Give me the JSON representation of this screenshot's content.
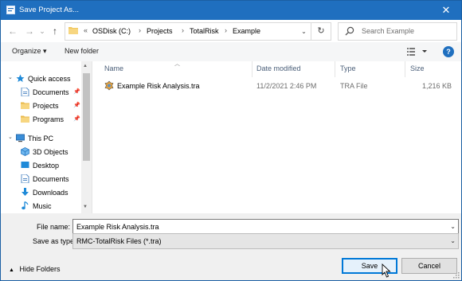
{
  "window": {
    "title": "Save Project As...",
    "close_glyph": "✕"
  },
  "nav": {
    "back_glyph": "←",
    "forward_glyph": "→",
    "recent_glyph": "⌄",
    "up_glyph": "↑",
    "breadcrumb_prefix": "«",
    "breadcrumbs": [
      "OSDisk (C:)",
      "Projects",
      "TotalRisk",
      "Example"
    ],
    "separator": "›",
    "dropdown_glyph": "⌄",
    "refresh_glyph": "↻",
    "search_placeholder": "Search Example"
  },
  "toolbar": {
    "organize_label": "Organize ▾",
    "new_folder_label": "New folder",
    "help_label": "?"
  },
  "sidebar": {
    "items": [
      {
        "label": "Quick access",
        "icon": "star-icon",
        "pinned": false
      },
      {
        "label": "Documents",
        "icon": "documents-icon",
        "pinned": true
      },
      {
        "label": "Projects",
        "icon": "folder-icon",
        "pinned": true
      },
      {
        "label": "Programs",
        "icon": "folder-icon",
        "pinned": true
      },
      {
        "label": "This PC",
        "icon": "computer-icon",
        "pinned": false
      },
      {
        "label": "3D Objects",
        "icon": "3d-objects-icon",
        "pinned": false
      },
      {
        "label": "Desktop",
        "icon": "desktop-icon",
        "pinned": false
      },
      {
        "label": "Documents",
        "icon": "documents-icon",
        "pinned": false
      },
      {
        "label": "Downloads",
        "icon": "downloads-icon",
        "pinned": false
      },
      {
        "label": "Music",
        "icon": "music-icon",
        "pinned": false
      }
    ],
    "pin_glyph": "📌"
  },
  "columns": {
    "name": "Name",
    "date": "Date modified",
    "type": "Type",
    "size": "Size"
  },
  "files": [
    {
      "name": "Example Risk Analysis.tra",
      "date": "11/2/2021 2:46 PM",
      "type": "TRA File",
      "size": "1,216 KB"
    }
  ],
  "form": {
    "file_name_label": "File name:",
    "file_name_value": "Example Risk Analysis.tra",
    "save_type_label": "Save as type:",
    "save_type_value": "RMC-TotalRisk Files (*.tra)",
    "hide_folders_label": "Hide Folders",
    "save_label": "Save",
    "cancel_label": "Cancel"
  },
  "colors": {
    "accent": "#1f6fbf",
    "button_focus": "#0078d7",
    "folder": "#f0c75e"
  }
}
